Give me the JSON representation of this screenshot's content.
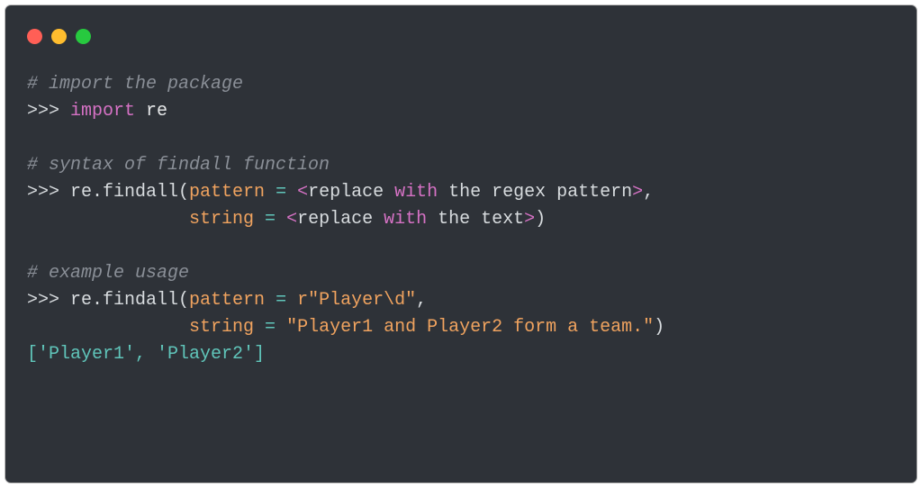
{
  "traffic_lights": {
    "close_color": "#ff5f56",
    "minimize_color": "#ffbd2e",
    "maximize_color": "#27c93f"
  },
  "code": {
    "comment1": "# import the package",
    "line1": {
      "prompt": ">>> ",
      "keyword": "import",
      "module": " re"
    },
    "comment2": "# syntax of findall function",
    "line2": {
      "prompt": ">>> ",
      "call": "re.findall(",
      "param1": "pattern",
      "eq1": " = ",
      "bracket1": "<",
      "text1": "replace ",
      "with1": "with",
      "text2": " the regex pattern",
      "bracket2": ">",
      "comma": ","
    },
    "line3": {
      "indent": "               ",
      "param2": "string",
      "eq2": " = ",
      "bracket3": "<",
      "text3": "replace ",
      "with2": "with",
      "text4": " the text",
      "bracket4": ">",
      "close": ")"
    },
    "comment3": "# example usage",
    "line4": {
      "prompt": ">>> ",
      "call": "re.findall(",
      "param1": "pattern",
      "eq1": " = ",
      "str1": "r\"Player\\d\"",
      "comma": ","
    },
    "line5": {
      "indent": "               ",
      "param2": "string",
      "eq2": " = ",
      "str2": "\"Player1 and Player2 form a team.\"",
      "close": ")"
    },
    "result": "['Player1', 'Player2']"
  }
}
